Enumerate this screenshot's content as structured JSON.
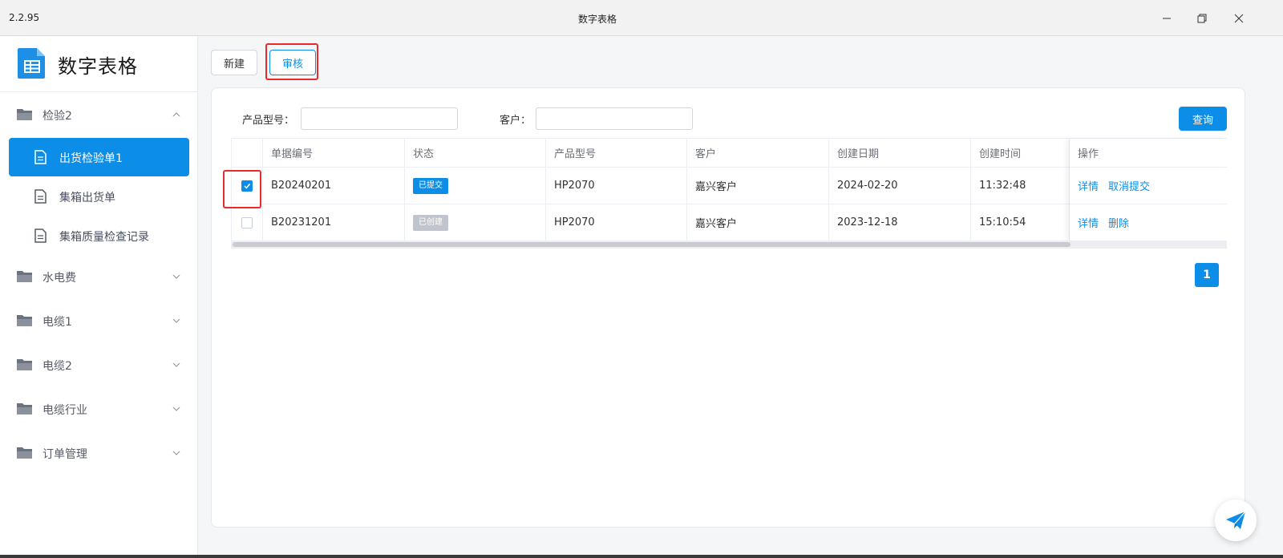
{
  "window": {
    "version": "2.2.95",
    "title": "数字表格",
    "controls": [
      "minimize-icon",
      "restore-icon",
      "close-icon"
    ]
  },
  "sidebar": {
    "app_name": "数字表格",
    "groups": [
      {
        "label": "检验2",
        "expanded": true,
        "items": [
          {
            "label": "出货检验单1",
            "active": true
          },
          {
            "label": "集箱出货单",
            "active": false
          },
          {
            "label": "集箱质量检查记录",
            "active": false
          }
        ]
      },
      {
        "label": "水电费",
        "expanded": false
      },
      {
        "label": "电缆1",
        "expanded": false
      },
      {
        "label": "电缆2",
        "expanded": false
      },
      {
        "label": "电缆行业",
        "expanded": false
      },
      {
        "label": "订单管理",
        "expanded": false
      }
    ]
  },
  "toolbar": {
    "new_label": "新建",
    "audit_label": "审核"
  },
  "filters": {
    "product_label": "产品型号：",
    "product_value": "",
    "customer_label": "客户：",
    "customer_value": "",
    "query_label": "查询"
  },
  "table": {
    "columns": [
      "单据编号",
      "状态",
      "产品型号",
      "客户",
      "创建日期",
      "创建时间",
      "操作"
    ],
    "rows": [
      {
        "checked": true,
        "code": "B20240201",
        "status": "已提交",
        "status_color": "#0c8ee8",
        "product": "HP2070",
        "customer": "嘉兴客户",
        "date": "2024-02-20",
        "time": "11:32:48",
        "actions": [
          "详情",
          "取消提交"
        ]
      },
      {
        "checked": false,
        "code": "B20231201",
        "status": "已创建",
        "status_color": "#c0c4cc",
        "product": "HP2070",
        "customer": "嘉兴客户",
        "date": "2023-12-18",
        "time": "15:10:54",
        "actions": [
          "详情",
          "删除"
        ]
      }
    ]
  },
  "pagination": {
    "current": "1"
  },
  "colors": {
    "accent": "#0c8ee8",
    "highlight": "#e82a2a"
  }
}
